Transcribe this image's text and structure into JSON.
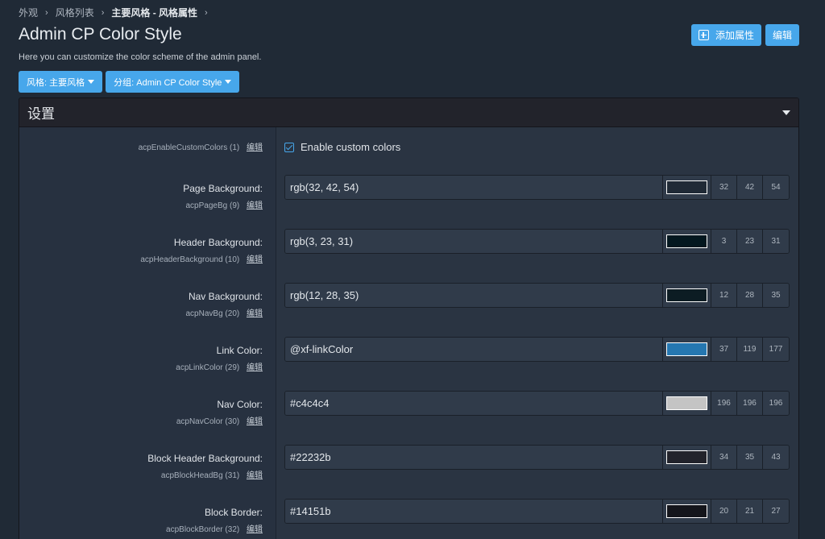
{
  "breadcrumb": {
    "items": [
      "外观",
      "风格列表",
      "主要风格 - 风格属性"
    ]
  },
  "page": {
    "title": "Admin CP Color Style",
    "description": "Here you can customize the color scheme of the admin panel."
  },
  "actions": {
    "add_property": "添加属性",
    "edit": "编辑"
  },
  "filters": {
    "style": "风格:  主要风格",
    "group": "分组:  Admin CP Color Style"
  },
  "block": {
    "title": "设置"
  },
  "checkbox_option": {
    "name": "acpEnableCustomColors",
    "order": "(1)",
    "edit": "编辑",
    "label": "Enable custom colors",
    "checked": true
  },
  "options": [
    {
      "title": "Page Background:",
      "name": "acpPageBg",
      "order": "(9)",
      "edit": "编辑",
      "value": "rgb(32, 42, 54)",
      "swatch": "#202a36",
      "r": "32",
      "g": "42",
      "b": "54"
    },
    {
      "title": "Header Background:",
      "name": "acpHeaderBackground",
      "order": "(10)",
      "edit": "编辑",
      "value": "rgb(3, 23, 31)",
      "swatch": "#03171f",
      "r": "3",
      "g": "23",
      "b": "31"
    },
    {
      "title": "Nav Background:",
      "name": "acpNavBg",
      "order": "(20)",
      "edit": "编辑",
      "value": "rgb(12, 28, 35)",
      "swatch": "#0c1c23",
      "r": "12",
      "g": "28",
      "b": "35"
    },
    {
      "title": "Link Color:",
      "name": "acpLinkColor",
      "order": "(29)",
      "edit": "编辑",
      "value": "@xf-linkColor",
      "swatch": "#2577b1",
      "r": "37",
      "g": "119",
      "b": "177"
    },
    {
      "title": "Nav Color:",
      "name": "acpNavColor",
      "order": "(30)",
      "edit": "编辑",
      "value": "#c4c4c4",
      "swatch": "#c4c4c4",
      "r": "196",
      "g": "196",
      "b": "196"
    },
    {
      "title": "Block Header Background:",
      "name": "acpBlockHeadBg",
      "order": "(31)",
      "edit": "编辑",
      "value": "#22232b",
      "swatch": "#22232b",
      "r": "34",
      "g": "35",
      "b": "43"
    },
    {
      "title": "Block Border:",
      "name": "acpBlockBorder",
      "order": "(32)",
      "edit": "编辑",
      "value": "#14151b",
      "swatch": "#14151b",
      "r": "20",
      "g": "21",
      "b": "27"
    }
  ]
}
